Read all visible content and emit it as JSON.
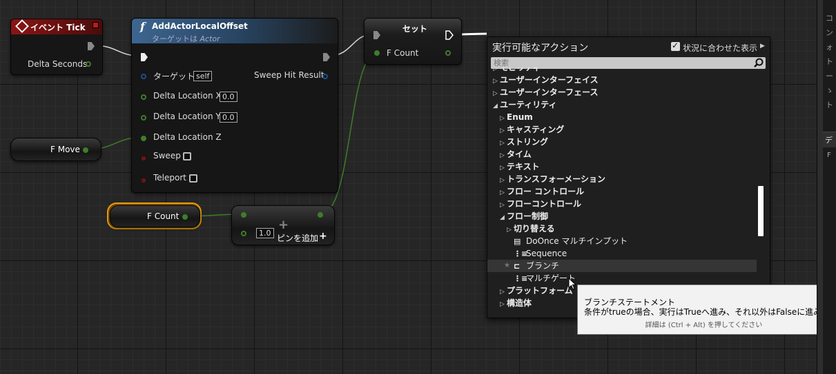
{
  "nodes": {
    "event_tick": {
      "title": "イベント Tick",
      "delta_seconds": "Delta Seconds"
    },
    "add_offset": {
      "title": "AddActorLocalOffset",
      "subtitle_prefix": "ターゲットは",
      "subtitle_target": "Actor",
      "target_label": "ターゲット",
      "target_value": "self",
      "sweep_hit": "Sweep Hit Result",
      "delta_x": "Delta Location X",
      "delta_x_value": "0.0",
      "delta_y": "Delta Location Y",
      "delta_y_value": "0.0",
      "delta_z": "Delta Location Z",
      "sweep": "Sweep",
      "teleport": "Teleport"
    },
    "set_node": {
      "title": "セット",
      "f_count": "F Count"
    },
    "f_move": {
      "label": "F Move"
    },
    "f_count_getter": {
      "label": "F Count"
    },
    "add_node": {
      "value": "1.0",
      "add_pin": "ピンを追加"
    }
  },
  "menu": {
    "title": "実行可能なアクション",
    "context_label": "状況に合わせた表示",
    "search_placeholder": "検索",
    "items": [
      {
        "label": "モビリティ",
        "level": 0,
        "arrow": "▷",
        "bold": true
      },
      {
        "label": "ユーザーインターフェイス",
        "level": 0,
        "arrow": "▷",
        "bold": true
      },
      {
        "label": "ユーザーインターフェース",
        "level": 0,
        "arrow": "▷",
        "bold": true
      },
      {
        "label": "ユーティリティ",
        "level": 0,
        "arrow": "◢",
        "bold": true
      },
      {
        "label": "Enum",
        "level": 1,
        "arrow": "▷",
        "bold": true
      },
      {
        "label": "キャスティング",
        "level": 1,
        "arrow": "▷",
        "bold": true
      },
      {
        "label": "ストリング",
        "level": 1,
        "arrow": "▷",
        "bold": true
      },
      {
        "label": "タイム",
        "level": 1,
        "arrow": "▷",
        "bold": true
      },
      {
        "label": "テキスト",
        "level": 1,
        "arrow": "▷",
        "bold": true
      },
      {
        "label": "トランスフォーメーション",
        "level": 1,
        "arrow": "▷",
        "bold": true
      },
      {
        "label": "フロー コントロール",
        "level": 1,
        "arrow": "▷",
        "bold": true
      },
      {
        "label": "フローコントロール",
        "level": 1,
        "arrow": "▷",
        "bold": true
      },
      {
        "label": "フロー制御",
        "level": 1,
        "arrow": "◢",
        "bold": true
      },
      {
        "label": "切り替える",
        "level": 2,
        "arrow": "▷",
        "bold": true
      },
      {
        "label": "DoOnce マルチインプット",
        "level": 3,
        "icon": "▤",
        "bold": false
      },
      {
        "label": "Sequence",
        "level": 3,
        "icon": "⋮≡",
        "bold": false
      },
      {
        "label": "ブランチ",
        "level": 3,
        "icon": "⊏",
        "bold": false,
        "star": "★"
      },
      {
        "label": "マルチゲート",
        "level": 3,
        "icon": "⋮≡",
        "bold": false
      },
      {
        "label": "プラットフォーム",
        "level": 1,
        "arrow": "▷",
        "bold": true
      },
      {
        "label": "構造体",
        "level": 1,
        "arrow": "▷",
        "bold": true
      }
    ]
  },
  "tooltip": {
    "title": "ブランチステートメント",
    "description": "条件がtrueの場合、実行はTrueへ進み、それ以外はFalseに進みます",
    "hint": "詳細は (Ctrl + Alt) を押してください"
  },
  "right_panel": {
    "chars": [
      "コ",
      "ン",
      "ォ",
      "ト",
      "ー",
      "ゝ",
      "ト"
    ],
    "section": "デ",
    "section_sub": "F"
  },
  "colors": {
    "event_header": "#8b1414",
    "function_header": "#3d6690",
    "set_header": "#3a3a3a",
    "float_pin": "#3f7d2b",
    "object_pin": "#1e4f8a",
    "selected_outline": "#e8a10f"
  }
}
